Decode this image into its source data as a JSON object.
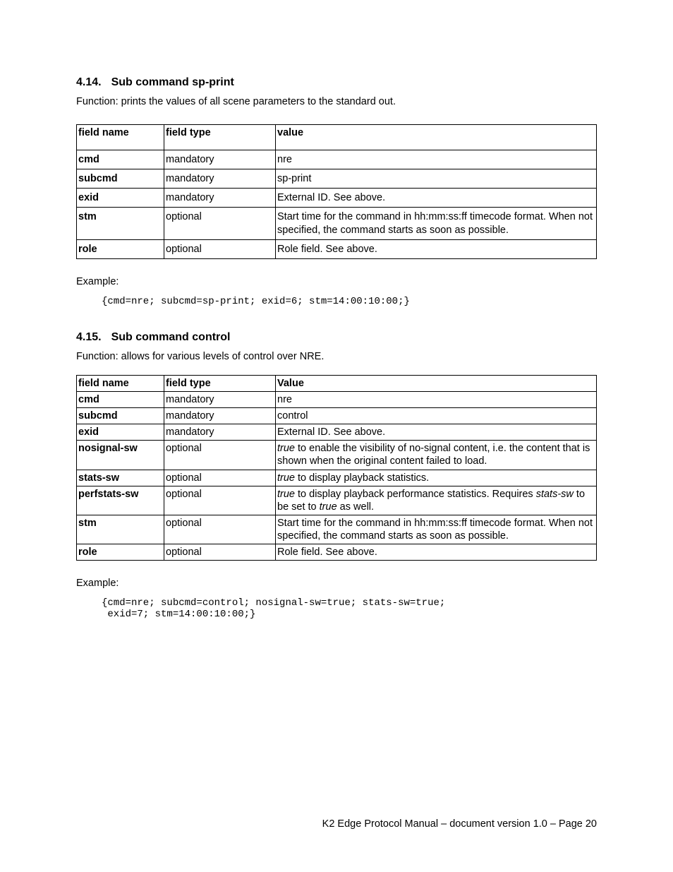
{
  "section1": {
    "number": "4.14.",
    "title": "Sub command sp-print",
    "function": "Function: prints the values of all scene parameters to the standard out.",
    "headers": {
      "c1": "field name",
      "c2": "field type",
      "c3": "value"
    },
    "rows": [
      {
        "name": "cmd",
        "type": "mandatory",
        "value": "nre"
      },
      {
        "name": "subcmd",
        "type": "mandatory",
        "value": "sp-print"
      },
      {
        "name": "exid",
        "type": "mandatory",
        "value": "External ID. See above."
      },
      {
        "name": "stm",
        "type": "optional",
        "value": "Start time for the command in hh:mm:ss:ff timecode format. When not specified, the command starts as soon as possible."
      },
      {
        "name": "role",
        "type": "optional",
        "value": "Role field. See above."
      }
    ],
    "example_label": "Example:",
    "example": "{cmd=nre; subcmd=sp-print; exid=6; stm=14:00:10:00;}"
  },
  "section2": {
    "number": "4.15.",
    "title": "Sub command control",
    "function": "Function: allows for various levels of control over NRE.",
    "headers": {
      "c1": "field name",
      "c2": "field type",
      "c3": "Value"
    },
    "rows": {
      "r0": {
        "name": "cmd",
        "type": "mandatory",
        "value": "nre"
      },
      "r1": {
        "name": "subcmd",
        "type": "mandatory",
        "value": "control"
      },
      "r2": {
        "name": "exid",
        "type": "mandatory",
        "value": "External ID. See above."
      },
      "r3": {
        "name": "nosignal-sw",
        "type": "optional",
        "v_pre": "true",
        "v_post": " to enable the visibility of no-signal content, i.e. the content that is shown when the original content failed to load."
      },
      "r4": {
        "name": "stats-sw",
        "type": "optional",
        "v_pre": "true",
        "v_post": " to display playback statistics."
      },
      "r5": {
        "name": "perfstats-sw",
        "type": "optional",
        "v_a": "true",
        "v_b": " to display playback performance statistics. Requires ",
        "v_c": "stats-sw",
        "v_d": " to be set to ",
        "v_e": "true",
        "v_f": " as well."
      },
      "r6": {
        "name": "stm",
        "type": "optional",
        "value": "Start time for the command in hh:mm:ss:ff timecode format. When not specified, the command starts as soon as possible."
      },
      "r7": {
        "name": "role",
        "type": "optional",
        "value": "Role field. See above."
      }
    },
    "example_label": "Example:",
    "example": "{cmd=nre; subcmd=control; nosignal-sw=true; stats-sw=true;\n exid=7; stm=14:00:10:00;}"
  },
  "footer": "K2 Edge Protocol Manual – document version 1.0 – Page 20"
}
